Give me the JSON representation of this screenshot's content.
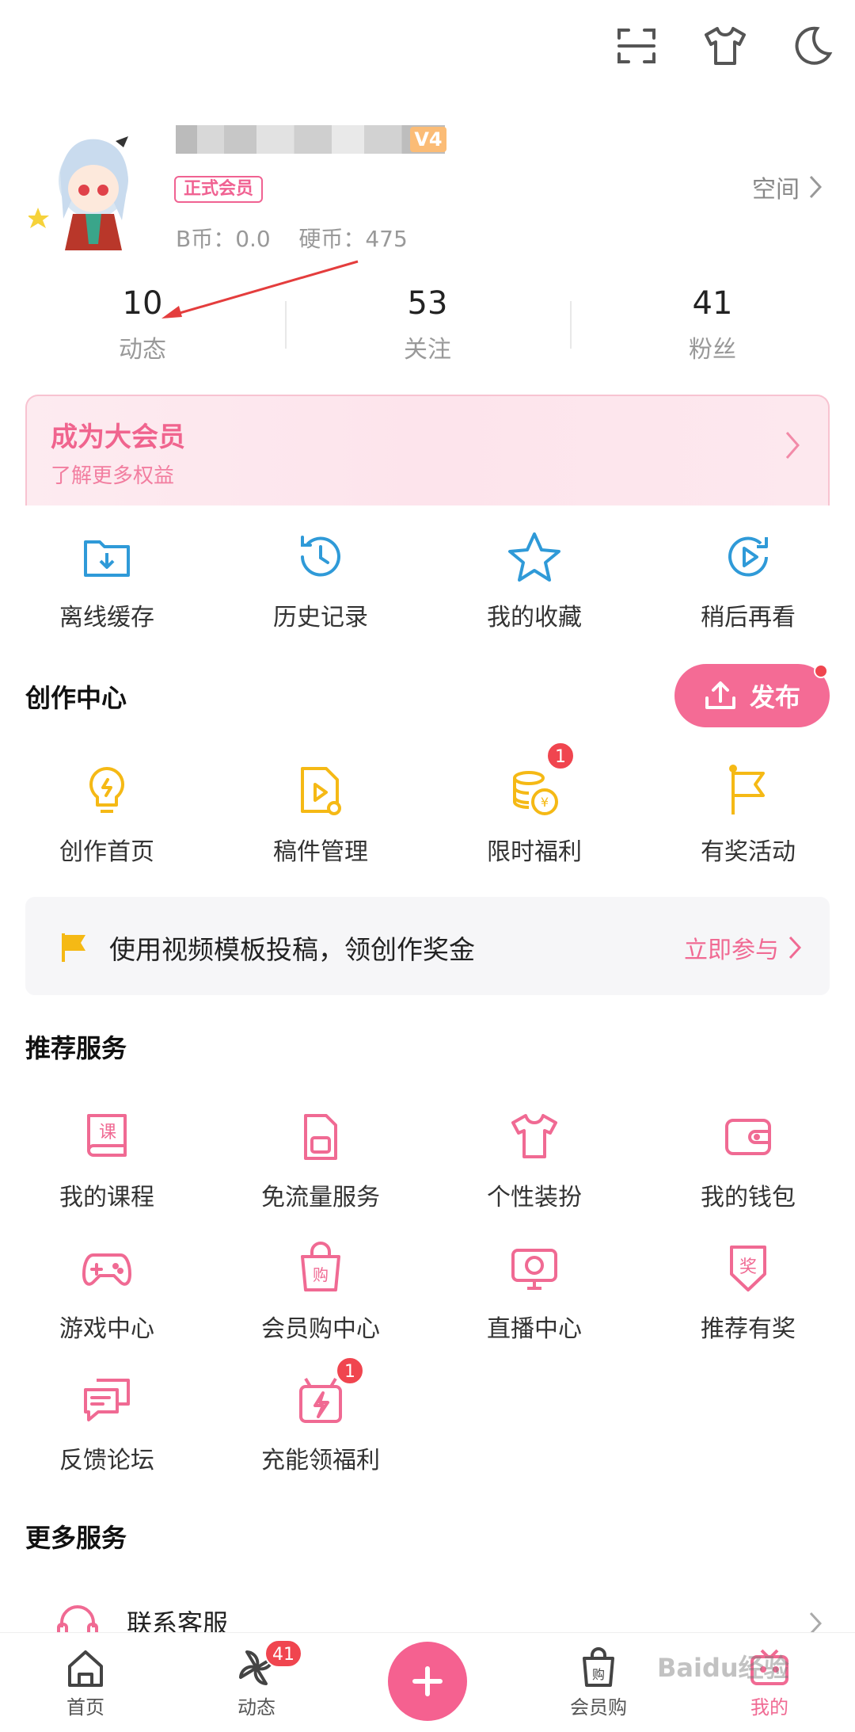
{
  "colors": {
    "accent": "#f06a93",
    "icon_blue": "#2f9ad8",
    "icon_yellow": "#f5b915",
    "icon_pink": "#f06a93",
    "badge_red": "#f0454f"
  },
  "top_icons": [
    "scan-icon",
    "tshirt-icon",
    "moon-icon"
  ],
  "profile": {
    "level": "V4",
    "vip_badge": "正式会员",
    "coins_text": "B币：0.0    硬币：475",
    "space_label": "空间"
  },
  "stats": [
    {
      "num": "10",
      "label": "动态"
    },
    {
      "num": "53",
      "label": "关注"
    },
    {
      "num": "41",
      "label": "粉丝"
    }
  ],
  "vip_banner": {
    "title": "成为大会员",
    "subtitle": "了解更多权益"
  },
  "quick_items": [
    {
      "label": "离线缓存",
      "icon": "download-folder-icon"
    },
    {
      "label": "历史记录",
      "icon": "history-clock-icon"
    },
    {
      "label": "我的收藏",
      "icon": "star-icon"
    },
    {
      "label": "稍后再看",
      "icon": "watch-later-icon"
    }
  ],
  "creator": {
    "title": "创作中心",
    "publish_label": "发布",
    "items": [
      {
        "label": "创作首页",
        "icon": "lightbulb-icon"
      },
      {
        "label": "稿件管理",
        "icon": "video-file-icon"
      },
      {
        "label": "限时福利",
        "icon": "coins-icon",
        "badge": "1"
      },
      {
        "label": "有奖活动",
        "icon": "flag-icon"
      }
    ]
  },
  "promo": {
    "text": "使用视频模板投稿，领创作奖金",
    "action": "立即参与"
  },
  "recommended": {
    "title": "推荐服务",
    "items": [
      {
        "label": "我的课程",
        "icon": "course-book-icon"
      },
      {
        "label": "免流量服务",
        "icon": "sim-card-icon"
      },
      {
        "label": "个性装扮",
        "icon": "tshirt-icon"
      },
      {
        "label": "我的钱包",
        "icon": "wallet-icon"
      },
      {
        "label": "游戏中心",
        "icon": "gamepad-icon"
      },
      {
        "label": "会员购中心",
        "icon": "shopping-bag-icon"
      },
      {
        "label": "直播中心",
        "icon": "live-tv-icon"
      },
      {
        "label": "推荐有奖",
        "icon": "reward-badge-icon"
      },
      {
        "label": "反馈论坛",
        "icon": "chat-bubble-icon"
      },
      {
        "label": "充能领福利",
        "icon": "gift-bolt-icon",
        "badge": "1"
      }
    ]
  },
  "more": {
    "title": "更多服务",
    "first_item": "联系客服"
  },
  "tabbar": [
    {
      "label": "首页",
      "icon": "home-icon"
    },
    {
      "label": "动态",
      "icon": "pinwheel-icon",
      "badge": "41"
    },
    {
      "label": "",
      "icon": "plus-icon"
    },
    {
      "label": "会员购",
      "icon": "shopping-bag-icon"
    },
    {
      "label": "我的",
      "icon": "tv-icon"
    }
  ],
  "watermark": "Baidu经验"
}
